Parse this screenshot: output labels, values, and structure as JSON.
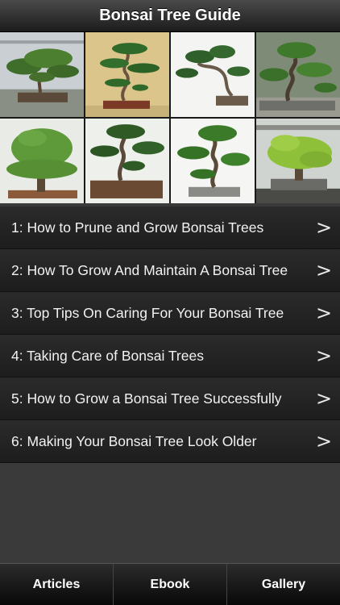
{
  "navbar": {
    "title": "Bonsai Tree Guide"
  },
  "gallery": {
    "count": 8
  },
  "articles": [
    {
      "label": "1: How to Prune and Grow Bonsai Trees"
    },
    {
      "label": "2: How To Grow And Maintain A Bonsai Tree"
    },
    {
      "label": "3: Top Tips On Caring For Your Bonsai Tree"
    },
    {
      "label": "4: Taking Care of Bonsai Trees"
    },
    {
      "label": "5: How to Grow a Bonsai Tree Successfully"
    },
    {
      "label": "6: Making Your Bonsai Tree Look Older"
    }
  ],
  "chevron": ">",
  "tabs": [
    {
      "label": "Articles"
    },
    {
      "label": "Ebook"
    },
    {
      "label": "Gallery"
    }
  ],
  "colors": {
    "background": "#3a3a3a",
    "row": "#242424",
    "foliage": "#4f8a2e"
  }
}
